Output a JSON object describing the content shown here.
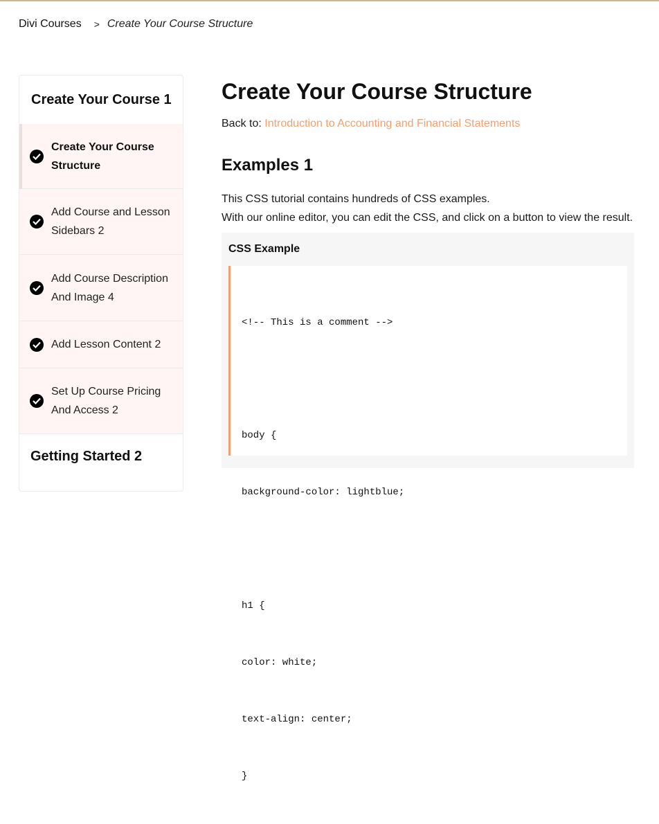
{
  "breadcrumb": {
    "home": "Divi Courses",
    "separator": ">",
    "current": "Create Your Course Structure"
  },
  "sidebar": {
    "title": "Create Your Course 1",
    "lessons": [
      {
        "label": "Create Your Course Structure",
        "active": true
      },
      {
        "label": "Add Course and Lesson Sidebars 2",
        "active": false
      },
      {
        "label": "Add Course Description And Image 4",
        "active": false
      },
      {
        "label": "Add Lesson Content 2",
        "active": false
      },
      {
        "label": "Set Up Course Pricing And Access 2",
        "active": false
      }
    ],
    "next_section": "Getting Started 2"
  },
  "main": {
    "title": "Create Your Course Structure",
    "back_prefix": "Back to:",
    "back_link": "Introduction to Accounting and Financial Statements",
    "section_title": "Examples 1",
    "intro_line1": "This CSS tutorial contains hundreds of CSS examples.",
    "intro_line2": "With our online editor, you can edit the CSS, and click on a button to view the result.",
    "example": {
      "title": "CSS Example",
      "code_lines": [
        "<!-- This is a comment -->",
        "",
        "body {",
        "background-color: lightblue;",
        "",
        "h1 {",
        "color: white;",
        "text-align: center;",
        "}"
      ]
    }
  },
  "colors": {
    "accent": "#f0a070",
    "lesson_bg": "#fff5f4",
    "code_bg": "#f6f6f6"
  }
}
